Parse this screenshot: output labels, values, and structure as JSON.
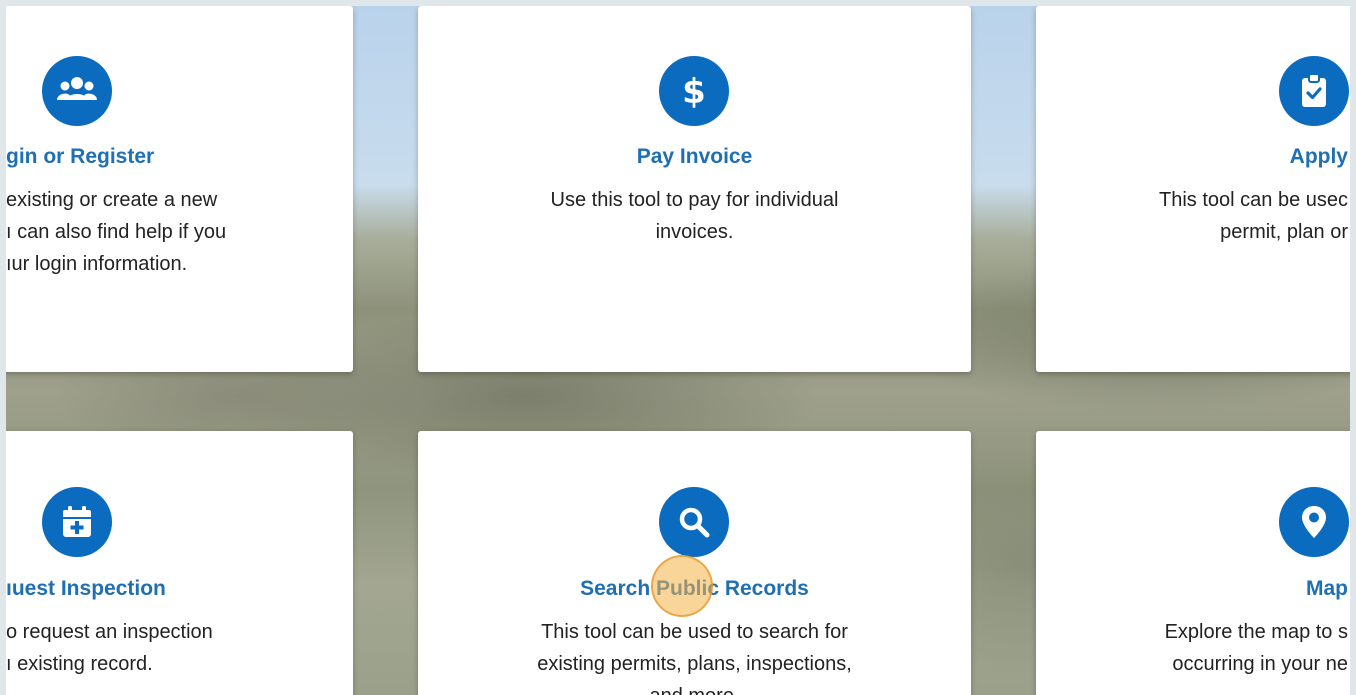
{
  "cards": [
    {
      "icon": "users-icon",
      "title": "gin or Register",
      "desc": [
        "existing or create a new",
        "ı can also find help if you",
        "ıur login information."
      ]
    },
    {
      "icon": "dollar-icon",
      "title": "Pay Invoice",
      "desc": [
        "Use this tool to pay for individual",
        "invoices."
      ]
    },
    {
      "icon": "clipboard-check-icon",
      "title": "Apply",
      "desc": [
        "This tool can be usec",
        "permit, plan or"
      ]
    },
    {
      "icon": "calendar-plus-icon",
      "title": "ıuest Inspection",
      "desc": [
        "o request an inspection",
        "ı existing record."
      ]
    },
    {
      "icon": "search-icon",
      "title": "Search Public Records",
      "desc": [
        "This tool can be used to search for",
        "existing permits, plans, inspections,",
        "and more."
      ]
    },
    {
      "icon": "map-pin-icon",
      "title": "Map",
      "desc": [
        "Explore the map to s",
        "occurring in your ne"
      ]
    }
  ],
  "colors": {
    "accent": "#0b6bbf",
    "title": "#1f6fb5",
    "click_indicator": "#f5b246"
  }
}
